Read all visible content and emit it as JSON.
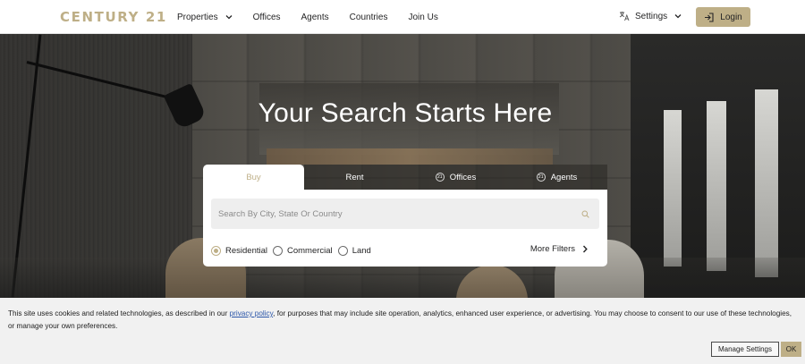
{
  "brand": {
    "logo": "CENTURY 21",
    "accent_color": "#beaf87"
  },
  "nav": {
    "items": [
      {
        "label": "Properties",
        "has_dropdown": true
      },
      {
        "label": "Offices",
        "has_dropdown": false
      },
      {
        "label": "Agents",
        "has_dropdown": false
      },
      {
        "label": "Countries",
        "has_dropdown": false
      },
      {
        "label": "Join Us",
        "has_dropdown": false
      }
    ],
    "settings_label": "Settings",
    "settings_icon": "translate-icon",
    "login_label": "Login",
    "login_icon": "login-icon"
  },
  "hero": {
    "title": "Your Search Starts Here"
  },
  "search": {
    "tabs": [
      {
        "label": "Buy",
        "active": true
      },
      {
        "label": "Rent",
        "active": false
      },
      {
        "label": "Offices",
        "active": false,
        "icon": "c21-icon"
      },
      {
        "label": "Agents",
        "active": false,
        "icon": "c21-icon"
      }
    ],
    "placeholder": "Search By City, State Or Country",
    "search_icon": "search-icon",
    "property_types": [
      {
        "label": "Residential",
        "checked": true
      },
      {
        "label": "Commercial",
        "checked": false
      },
      {
        "label": "Land",
        "checked": false
      }
    ],
    "more_filters_label": "More Filters"
  },
  "cookie_banner": {
    "text_before": "This site uses cookies and related technologies, as described in our ",
    "link_text": "privacy policy",
    "text_after": ", for purposes that may include site operation, analytics, enhanced user experience, or advertising. You may choose to consent to our use of these technologies, or manage your own preferences.",
    "manage_label": "Manage Settings",
    "ok_label": "OK"
  }
}
